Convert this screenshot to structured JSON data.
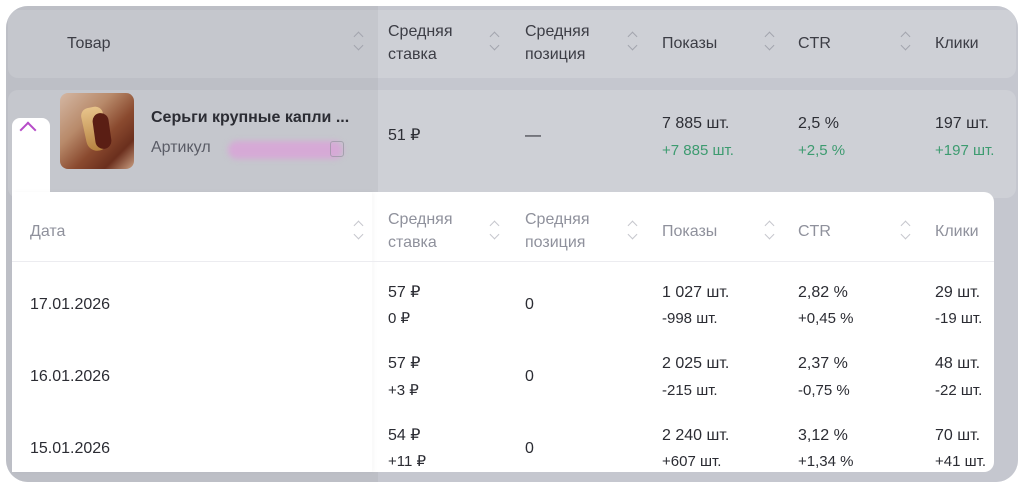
{
  "top_table": {
    "columns": [
      "Товар",
      "Средняя ставка",
      "Средняя позиция",
      "Показы",
      "CTR",
      "Клики"
    ],
    "product": {
      "title": "Серьги крупные капли ...",
      "article_label": "Артикул",
      "bid": "51 ₽",
      "position": "—",
      "impressions": "7 885 шт.",
      "impressions_delta": "+7 885 шт.",
      "ctr": "2,5 %",
      "ctr_delta": "+2,5 %",
      "clicks": "197 шт.",
      "clicks_delta": "+197 шт."
    }
  },
  "detail_table": {
    "columns": [
      "Дата",
      "Средняя ставка",
      "Средняя позиция",
      "Показы",
      "CTR",
      "Клики"
    ],
    "rows": [
      {
        "date": "17.01.2026",
        "bid": "57 ₽",
        "bid_delta": "0 ₽",
        "position": "0",
        "impressions": "1 027 шт.",
        "impressions_delta": "-998 шт.",
        "ctr": "2,82 %",
        "ctr_delta": "+0,45 %",
        "clicks": "29 шт.",
        "clicks_delta": "-19 шт."
      },
      {
        "date": "16.01.2026",
        "bid": "57 ₽",
        "bid_delta": "+3 ₽",
        "position": "0",
        "impressions": "2 025 шт.",
        "impressions_delta": "-215 шт.",
        "ctr": "2,37 %",
        "ctr_delta": "-0,75 %",
        "clicks": "48 шт.",
        "clicks_delta": "-22 шт."
      },
      {
        "date": "15.01.2026",
        "bid": "54 ₽",
        "bid_delta": "+11 ₽",
        "position": "0",
        "impressions": "2 240 шт.",
        "impressions_delta": "+607 шт.",
        "ctr": "3,12 %",
        "ctr_delta": "+1,34 %",
        "clicks": "70 шт.",
        "clicks_delta": "+41 шт."
      }
    ]
  },
  "colors": {
    "positive": "#2e9d6a",
    "negative": "#e5484d",
    "accent": "#b64cc8",
    "overlay": "#c5c7cf"
  },
  "icons": [
    "sort-icon",
    "chevron-up-icon",
    "copy-icon",
    "product-image"
  ]
}
